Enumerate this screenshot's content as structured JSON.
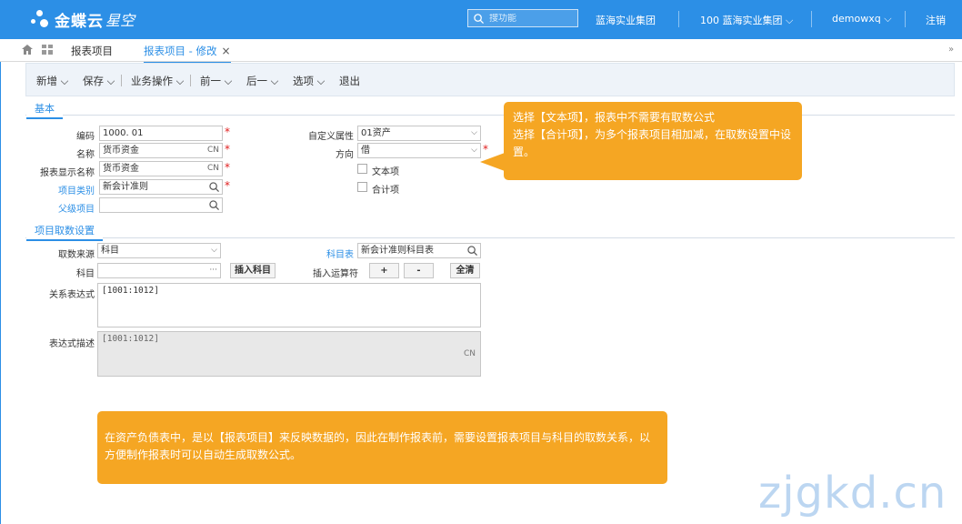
{
  "header": {
    "brand": "金蝶云",
    "brand_sub": "星空",
    "search_placeholder": "搜功能",
    "org": "蓝海实业集团",
    "org_select": "100 蓝海实业集团",
    "user": "demowxq",
    "logout": "注销"
  },
  "tabs": {
    "item1": "报表项目",
    "item2": "报表项目 - 修改"
  },
  "toolbar": {
    "add": "新增",
    "save": "保存",
    "biz": "业务操作",
    "prev": "前一",
    "next": "后一",
    "options": "选项",
    "exit": "退出"
  },
  "section_basic": "基本",
  "form": {
    "code_label": "编码",
    "code_value": "1000. 01",
    "name_label": "名称",
    "name_value": "货币资金",
    "display_label": "报表显示名称",
    "display_value": "货币资金",
    "category_label": "项目类别",
    "category_value": "新会计准则",
    "parent_label": "父级项目",
    "parent_value": "",
    "custom_attr_label": "自定义属性",
    "custom_attr_value": "01资产",
    "direction_label": "方向",
    "direction_value": "借",
    "text_item_label": "文本项",
    "total_item_label": "合计项",
    "cn_suffix": "CN"
  },
  "section_fetch": "项目取数设置",
  "fetch": {
    "source_label": "取数来源",
    "source_value": "科目",
    "subject_table_label": "科目表",
    "subject_table_value": "新会计准则科目表",
    "subject_label": "科目",
    "subject_value": "",
    "insert_subject": "插入科目",
    "insert_op_label": "插入运算符",
    "plus": "+",
    "minus": "-",
    "clear": "全清",
    "expr_label": "关系表达式",
    "expr_value": "[1001:1012]",
    "desc_label": "表达式描述",
    "desc_value": "[1001:1012]",
    "desc_suffix": "CN"
  },
  "callouts": {
    "top_line1": "选择【文本项】，报表中不需要有取数公式",
    "top_line2": "选择【合计项】，为多个报表项目相加减，在取数设置中设置。",
    "bottom": "在资产负债表中，是以【报表项目】来反映数据的，因此在制作报表前，需要设置报表项目与科目的取数关系，以方便制作报表时可以自动生成取数公式。"
  },
  "watermark": "zjgkd.cn",
  "colors": {
    "primary": "#2c8fe6",
    "callout": "#f5a623",
    "required": "#e02020"
  }
}
